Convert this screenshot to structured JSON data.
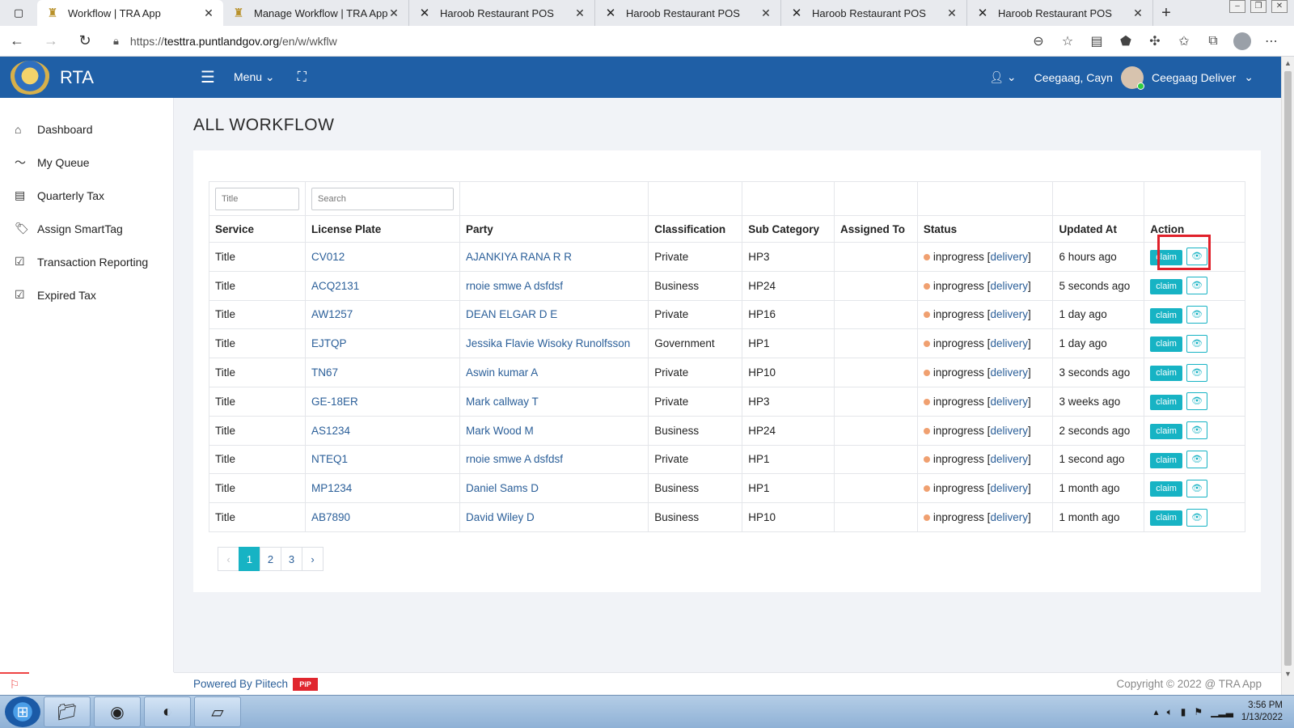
{
  "browser": {
    "tabs": [
      {
        "label": "Workflow | TRA App",
        "icon": "tra-crest-icon",
        "active": true
      },
      {
        "label": "Manage Workflow | TRA App",
        "icon": "tra-crest-icon",
        "active": false
      },
      {
        "label": "Haroob Restaurant POS",
        "icon": "x-logo-icon",
        "active": false
      },
      {
        "label": "Haroob Restaurant POS",
        "icon": "x-logo-icon",
        "active": false
      },
      {
        "label": "Haroob Restaurant POS",
        "icon": "x-logo-icon",
        "active": false
      },
      {
        "label": "Haroob Restaurant POS",
        "icon": "x-logo-icon",
        "active": false
      }
    ],
    "url_prefix": "https://",
    "url_host": "testtra.puntlandgov.org",
    "url_path": "/en/w/wkflw"
  },
  "header": {
    "brand": "RTA",
    "menu_label": "Menu",
    "org_name": "Ceegaag, Cayn",
    "user_name": "Ceegaag Deliver"
  },
  "sidebar": {
    "items": [
      {
        "label": "Dashboard",
        "icon": "home-icon"
      },
      {
        "label": "My Queue",
        "icon": "trend-line-icon"
      },
      {
        "label": "Quarterly Tax",
        "icon": "list-icon"
      },
      {
        "label": "Assign SmartTag",
        "icon": "tags-icon"
      },
      {
        "label": "Transaction Reporting",
        "icon": "checkbox-icon"
      },
      {
        "label": "Expired Tax",
        "icon": "checkbox-icon"
      }
    ]
  },
  "page": {
    "title": "ALL WORKFLOW",
    "filters": {
      "service_placeholder": "Title",
      "plate_placeholder": "Search"
    },
    "columns": [
      "Service",
      "License Plate",
      "Party",
      "Classification",
      "Sub Category",
      "Assigned To",
      "Status",
      "Updated At",
      "Action"
    ],
    "rows": [
      {
        "service": "Title",
        "plate": "CV012",
        "party": "AJANKIYA RANA R R",
        "classification": "Private",
        "sub": "HP3",
        "assigned": "",
        "status": "inprogress",
        "stage": "delivery",
        "updated": "6 hours ago"
      },
      {
        "service": "Title",
        "plate": "ACQ2131",
        "party": "rnoie smwe A dsfdsf",
        "classification": "Business",
        "sub": "HP24",
        "assigned": "",
        "status": "inprogress",
        "stage": "delivery",
        "updated": "5 seconds ago"
      },
      {
        "service": "Title",
        "plate": "AW1257",
        "party": "DEAN ELGAR D E",
        "classification": "Private",
        "sub": "HP16",
        "assigned": "",
        "status": "inprogress",
        "stage": "delivery",
        "updated": "1 day ago"
      },
      {
        "service": "Title",
        "plate": "EJTQP",
        "party": "Jessika Flavie Wisoky Runolfsson",
        "classification": "Government",
        "sub": "HP1",
        "assigned": "",
        "status": "inprogress",
        "stage": "delivery",
        "updated": "1 day ago"
      },
      {
        "service": "Title",
        "plate": "TN67",
        "party": "Aswin kumar A",
        "classification": "Private",
        "sub": "HP10",
        "assigned": "",
        "status": "inprogress",
        "stage": "delivery",
        "updated": "3 seconds ago"
      },
      {
        "service": "Title",
        "plate": "GE-18ER",
        "party": "Mark callway T",
        "classification": "Private",
        "sub": "HP3",
        "assigned": "",
        "status": "inprogress",
        "stage": "delivery",
        "updated": "3 weeks ago"
      },
      {
        "service": "Title",
        "plate": "AS1234",
        "party": "Mark Wood M",
        "classification": "Business",
        "sub": "HP24",
        "assigned": "",
        "status": "inprogress",
        "stage": "delivery",
        "updated": "2 seconds ago"
      },
      {
        "service": "Title",
        "plate": "NTEQ1",
        "party": "rnoie smwe A dsfdsf",
        "classification": "Private",
        "sub": "HP1",
        "assigned": "",
        "status": "inprogress",
        "stage": "delivery",
        "updated": "1 second ago"
      },
      {
        "service": "Title",
        "plate": "MP1234",
        "party": "Daniel Sams D",
        "classification": "Business",
        "sub": "HP1",
        "assigned": "",
        "status": "inprogress",
        "stage": "delivery",
        "updated": "1 month ago"
      },
      {
        "service": "Title",
        "plate": "AB7890",
        "party": "David Wiley D",
        "classification": "Business",
        "sub": "HP10",
        "assigned": "",
        "status": "inprogress",
        "stage": "delivery",
        "updated": "1 month ago"
      }
    ],
    "claim_label": "claim",
    "pagination": {
      "prev": "‹",
      "pages": [
        "1",
        "2",
        "3"
      ],
      "next": "›",
      "current": "1"
    }
  },
  "footer": {
    "powered": "Powered By Piitech",
    "badge": "PiP",
    "copyright": "Copyright © 2022 @ TRA App"
  },
  "taskbar": {
    "time": "3:56 PM",
    "date": "1/13/2022",
    "apps": [
      "file-explorer-icon",
      "chrome-icon",
      "edge-icon",
      "notepad-icon"
    ]
  },
  "colors": {
    "header_bg": "#1f5fa6",
    "accent": "#17b3c4",
    "link": "#2b5f99",
    "status_dot": "#f0a070",
    "highlight": "#e0202a"
  }
}
